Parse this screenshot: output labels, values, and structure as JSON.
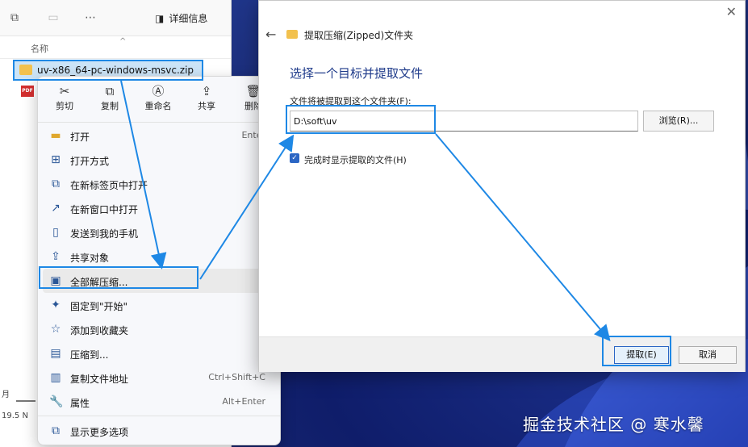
{
  "explorer": {
    "details_label": "详细信息",
    "column_name": "名称",
    "zip_file_name": "uv-x86_64-pc-windows-msvc.zip",
    "pdf_label": "PDF",
    "status_date": "月",
    "status_size": "19.5 N"
  },
  "context_menu": {
    "top_actions": [
      {
        "label": "剪切",
        "icon": "scissors-icon"
      },
      {
        "label": "复制",
        "icon": "copy-icon"
      },
      {
        "label": "重命名",
        "icon": "rename-icon"
      },
      {
        "label": "共享",
        "icon": "share-icon"
      },
      {
        "label": "删除",
        "icon": "trash-icon"
      }
    ],
    "items": [
      {
        "label": "打开",
        "shortcut": "Enter",
        "icon": "folder-open-icon"
      },
      {
        "label": "打开方式",
        "submenu": true,
        "icon": "open-with-icon"
      },
      {
        "label": "在新标签页中打开",
        "icon": "new-tab-icon"
      },
      {
        "label": "在新窗口中打开",
        "icon": "new-window-icon"
      },
      {
        "label": "发送到我的手机",
        "icon": "phone-icon"
      },
      {
        "label": "共享对象",
        "submenu": true,
        "icon": "share-object-icon"
      },
      {
        "label": "全部解压缩...",
        "icon": "extract-all-icon"
      },
      {
        "label": "固定到\"开始\"",
        "icon": "pin-icon"
      },
      {
        "label": "添加到收藏夹",
        "icon": "star-icon"
      },
      {
        "label": "压缩到...",
        "submenu": true,
        "icon": "compress-icon"
      },
      {
        "label": "复制文件地址",
        "shortcut": "Ctrl+Shift+C",
        "icon": "copy-path-icon"
      },
      {
        "label": "属性",
        "shortcut": "Alt+Enter",
        "icon": "wrench-icon"
      },
      {
        "label": "显示更多选项",
        "icon": "more-options-icon"
      }
    ]
  },
  "dialog": {
    "window_title": "提取压缩(Zipped)文件夹",
    "heading": "选择一个目标并提取文件",
    "path_label": "文件将被提取到这个文件夹(F):",
    "path_value": "D:\\soft\\uv",
    "browse_label": "浏览(R)...",
    "checkbox_label": "完成时显示提取的文件(H)",
    "checkbox_checked": true,
    "extract_label": "提取(E)",
    "cancel_label": "取消"
  },
  "watermark": "掘金技术社区 @ 寒水馨",
  "colors": {
    "annotation": "#1e88e5",
    "heading": "#1e3a8a",
    "selection": "#cce4f7"
  }
}
